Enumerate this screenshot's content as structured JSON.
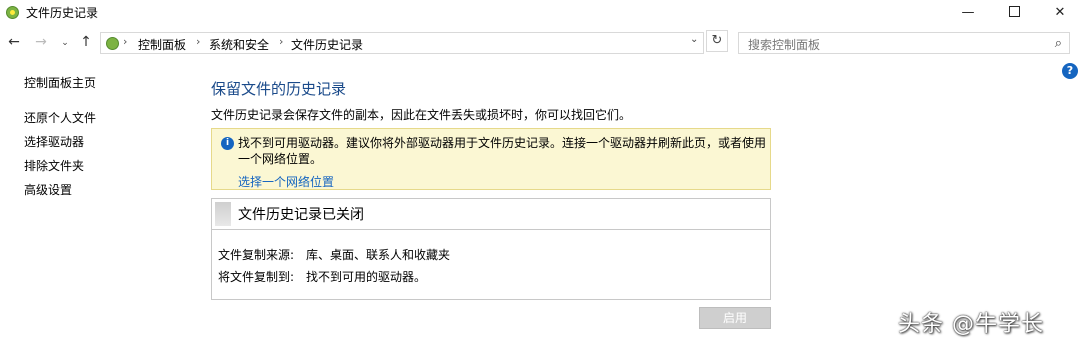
{
  "window": {
    "title": "文件历史记录",
    "minimize": "—",
    "maximize": "",
    "close": "✕"
  },
  "nav": {
    "back": "←",
    "forward": "→",
    "recent": "⌄",
    "up": "↑"
  },
  "address": {
    "breadcrumbs": [
      "控制面板",
      "系统和安全",
      "文件历史记录"
    ],
    "separator": "›",
    "dropdown": "⌄",
    "refresh": "↻"
  },
  "search": {
    "placeholder": "搜索控制面板",
    "icon": "⌕"
  },
  "help": {
    "icon": "?"
  },
  "sidebar": {
    "home": "控制面板主页",
    "items": [
      "还原个人文件",
      "选择驱动器",
      "排除文件夹",
      "高级设置"
    ]
  },
  "main": {
    "heading": "保留文件的历史记录",
    "description": "文件历史记录会保存文件的副本，因此在文件丢失或损坏时，你可以找回它们。",
    "warning": {
      "icon": "i",
      "text": "找不到可用驱动器。建议你将外部驱动器用于文件历史记录。连接一个驱动器并刷新此页，或者使用一个网络位置。",
      "link": "选择一个网络位置"
    },
    "status": {
      "title": "文件历史记录已关闭",
      "rows": [
        {
          "label": "文件复制来源:",
          "value": "库、桌面、联系人和收藏夹"
        },
        {
          "label": "将文件复制到:",
          "value": "找不到可用的驱动器。"
        }
      ]
    },
    "enable_button": "启用"
  },
  "watermark": "头条 @牛学长",
  "colors": {
    "heading": "#1a4a8a",
    "link": "#1565c0",
    "warning_bg": "#fbf7d3",
    "disabled_button": "#cfcfcf"
  }
}
